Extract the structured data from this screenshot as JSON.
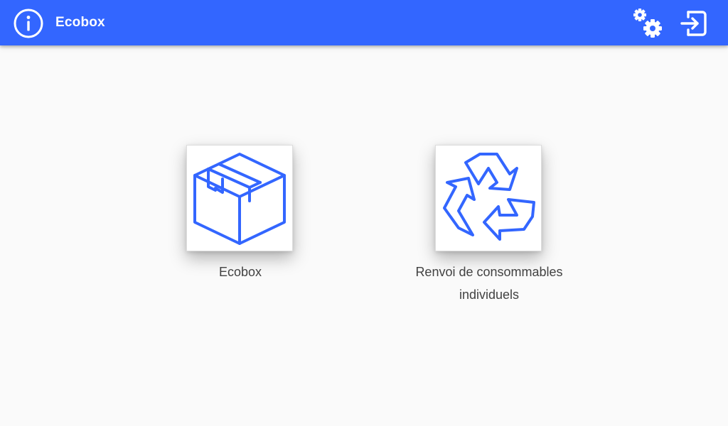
{
  "app": {
    "title": "Ecobox"
  },
  "header": {
    "info_icon": "info-circle-icon",
    "settings_icon": "gears-icon",
    "logout_icon": "sign-out-icon"
  },
  "tiles": [
    {
      "label": "Ecobox",
      "icon": "package-box-icon"
    },
    {
      "label": "Renvoi de consommables individuels",
      "icon": "recycle-icon"
    }
  ],
  "colors": {
    "primary": "#3366ff",
    "background": "#fafafa",
    "tile_bg": "#ffffff",
    "label_text": "#424242",
    "icon_stroke": "#3366ff"
  }
}
